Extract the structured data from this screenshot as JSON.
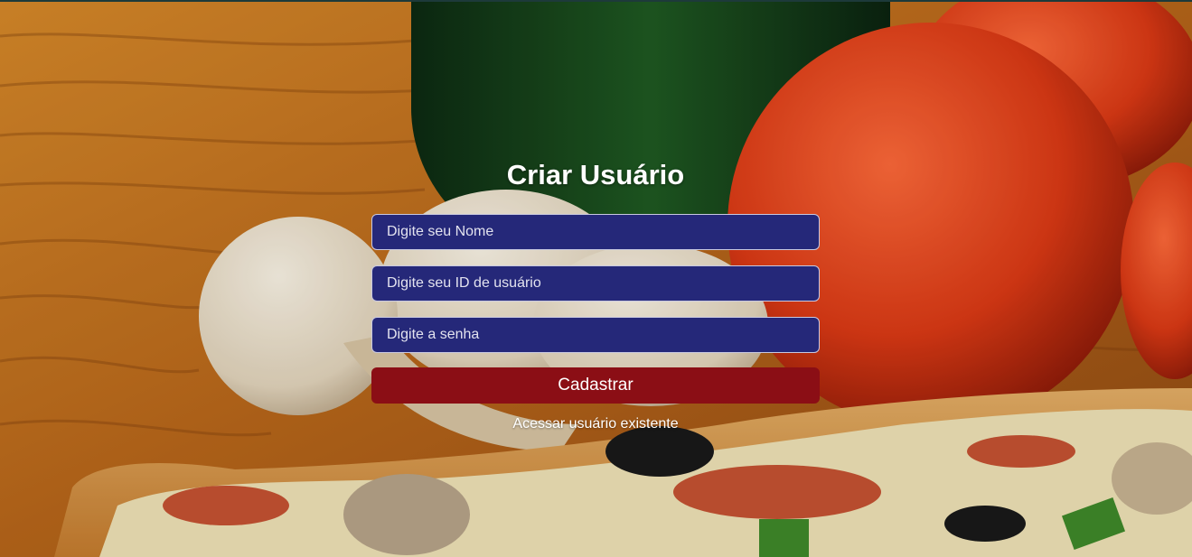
{
  "page": {
    "title": "Criar Usuário"
  },
  "form": {
    "name_placeholder": "Digite seu Nome",
    "userid_placeholder": "Digite seu ID de usuário",
    "password_placeholder": "Digite a senha",
    "submit_label": "Cadastrar",
    "login_link": "Acessar usuário existente"
  },
  "colors": {
    "input_bg": "#252879",
    "button_bg": "#8b0e15",
    "text": "#ffffff"
  }
}
